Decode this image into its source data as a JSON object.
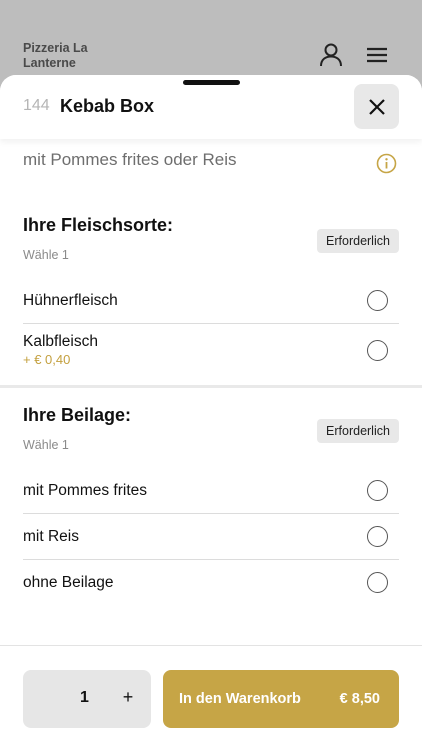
{
  "background": {
    "restaurant_name": "Pizzeria La Lanterne",
    "icons": [
      "user-icon",
      "menu-icon"
    ]
  },
  "header": {
    "item_number": "144",
    "item_title": "Kebab Box",
    "close_icon": "close-icon"
  },
  "description": {
    "text": "mit Pommes frites oder Reis",
    "info_icon": "info-icon"
  },
  "groups": [
    {
      "title": "Ihre Fleischsorte:",
      "hint": "Wähle 1",
      "badge": "Erforderlich",
      "options": [
        {
          "label": "Hühnerfleisch",
          "price": ""
        },
        {
          "label": "Kalbfleisch",
          "price": "+ € 0,40"
        }
      ]
    },
    {
      "title": "Ihre Beilage:",
      "hint": "Wähle 1",
      "badge": "Erforderlich",
      "options": [
        {
          "label": "mit Pommes frites",
          "price": ""
        },
        {
          "label": "mit Reis",
          "price": ""
        },
        {
          "label": "ohne Beilage",
          "price": ""
        }
      ]
    }
  ],
  "footer": {
    "quantity": "1",
    "plus_label": "+",
    "cart_label": "In den Warenkorb",
    "cart_price": "€ 8,50"
  },
  "colors": {
    "accent": "#c6a546",
    "price_text": "#c4a03f",
    "badge_bg": "#e8e8e8",
    "overlay": "#bdbdbd"
  }
}
